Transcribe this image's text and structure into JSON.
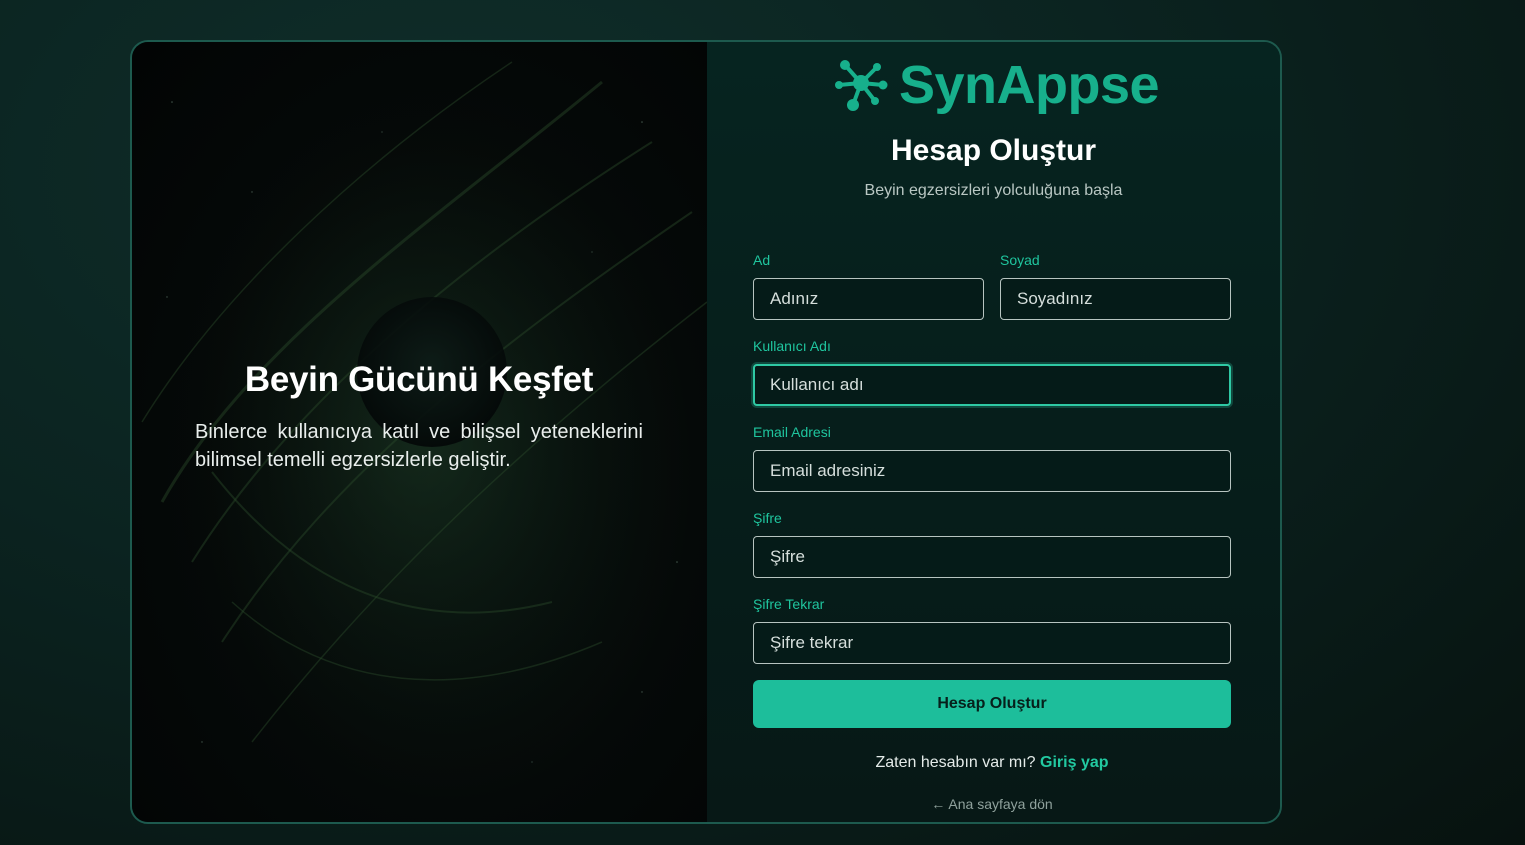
{
  "brand": {
    "name": "SynAppse",
    "accent": "#17b08c"
  },
  "hero": {
    "title": "Beyin Gücünü Keşfet",
    "text": "Binlerce kullanıcıya katıl ve bilişsel yeteneklerini bilimsel temelli egzersizlerle geliştir."
  },
  "form": {
    "title": "Hesap Oluştur",
    "subtitle": "Beyin egzersizleri yolculuğuna başla",
    "fields": {
      "first_name": {
        "label": "Ad",
        "placeholder": "Adınız",
        "value": ""
      },
      "last_name": {
        "label": "Soyad",
        "placeholder": "Soyadınız",
        "value": ""
      },
      "username": {
        "label": "Kullanıcı Adı",
        "placeholder": "Kullanıcı adı",
        "value": ""
      },
      "email": {
        "label": "Email Adresi",
        "placeholder": "Email adresiniz",
        "value": ""
      },
      "password": {
        "label": "Şifre",
        "placeholder": "Şifre",
        "value": ""
      },
      "password_confirm": {
        "label": "Şifre Tekrar",
        "placeholder": "Şifre tekrar",
        "value": ""
      }
    },
    "submit_label": "Hesap Oluştur",
    "login_prompt": "Zaten hesabın var mı?",
    "login_link": "Giriş yap",
    "back_link": "← Ana sayfaya dön"
  }
}
